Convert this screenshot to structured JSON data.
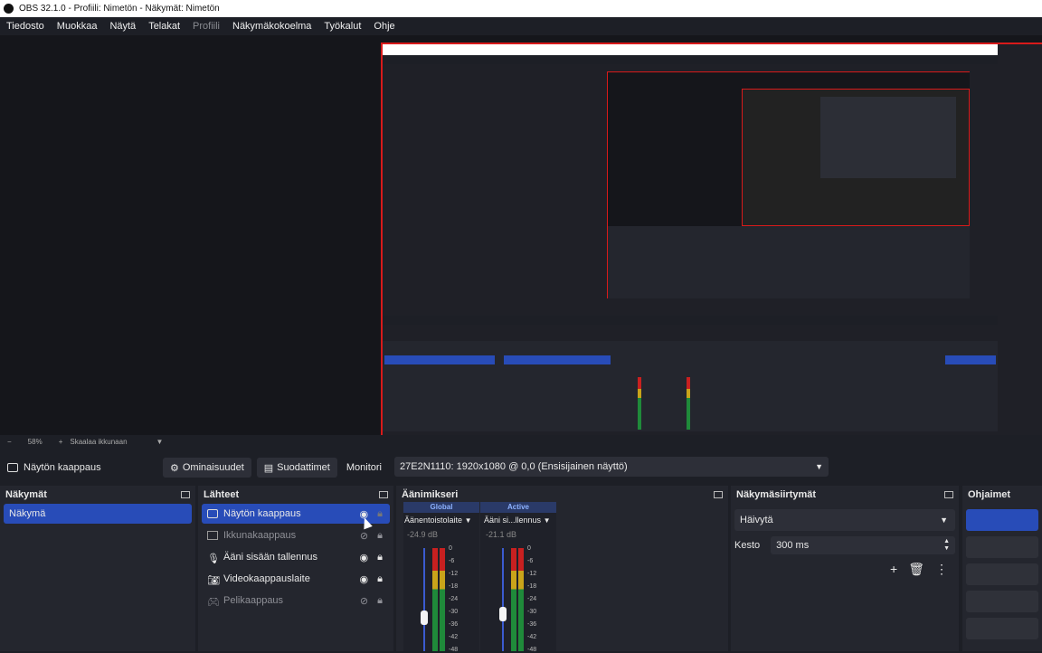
{
  "window": {
    "title": "OBS 32.1.0 - Profiili: Nimetön - Näkymät: Nimetön"
  },
  "menu": [
    {
      "label": "Tiedosto",
      "disabled": false
    },
    {
      "label": "Muokkaa",
      "disabled": false
    },
    {
      "label": "Näytä",
      "disabled": false
    },
    {
      "label": "Telakat",
      "disabled": false
    },
    {
      "label": "Profiili",
      "disabled": true
    },
    {
      "label": "Näkymäkokoelma",
      "disabled": false
    },
    {
      "label": "Työkalut",
      "disabled": false
    },
    {
      "label": "Ohje",
      "disabled": false
    }
  ],
  "zoom": {
    "minus": "−",
    "level": "58%",
    "plus": "+",
    "fit_label": "Skaalaa ikkunaan"
  },
  "context_bar": {
    "source_label": "Näytön kaappaus",
    "properties_label": "Ominaisuudet",
    "filters_label": "Suodattimet",
    "monitor_label": "Monitori",
    "monitor_value": "27E2N1110: 1920x1080 @ 0,0 (Ensisijainen näyttö)"
  },
  "scenes": {
    "title": "Näkymät",
    "items": [
      "Näkymä"
    ]
  },
  "sources": {
    "title": "Lähteet",
    "items": [
      {
        "label": "Näytön kaappaus",
        "icon": "monitor-icon",
        "visible": true,
        "selected": true
      },
      {
        "label": "Ikkunakaappaus",
        "icon": "window-icon",
        "visible": false,
        "selected": false
      },
      {
        "label": "Ääni sisään tallennus",
        "icon": "microphone-icon",
        "visible": true,
        "selected": false
      },
      {
        "label": "Videokaappauslaite",
        "icon": "camera-icon",
        "visible": true,
        "selected": false
      },
      {
        "label": "Pelikaappaus",
        "icon": "gamepad-icon",
        "visible": false,
        "selected": false
      }
    ]
  },
  "mixer": {
    "title": "Äänimikseri",
    "channels": [
      {
        "header": "Global",
        "name": "Äänentoistolaite",
        "db": "-24.9 dB",
        "level": 0.45
      },
      {
        "header": "Active",
        "name": "Ääni si...llennus",
        "db": "-21.1 dB",
        "level": 0.5
      }
    ],
    "scale": [
      "0",
      "-6",
      "-12",
      "-18",
      "-24",
      "-30",
      "-36",
      "-42",
      "-48"
    ]
  },
  "transitions": {
    "title": "Näkymäsiirtymät",
    "selected": "Häivytä",
    "duration_label": "Kesto",
    "duration_value": "300 ms"
  },
  "controls": {
    "title": "Ohjaimet"
  },
  "colors": {
    "accent": "#284cb8",
    "selection_red": "#d81a1a",
    "background": "#1d1f26"
  }
}
